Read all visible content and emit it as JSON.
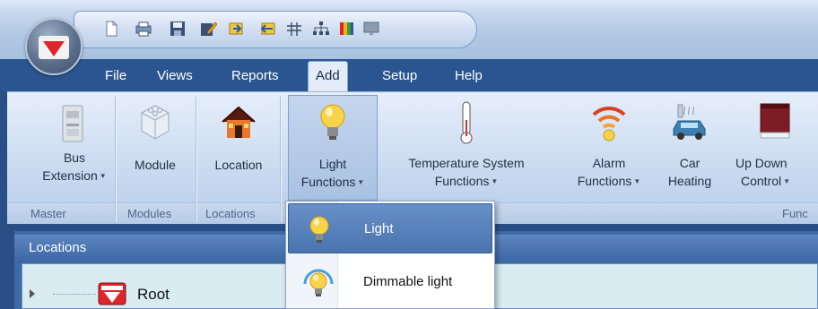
{
  "menu": {
    "tabs": [
      {
        "label": "File"
      },
      {
        "label": "Views"
      },
      {
        "label": "Reports"
      },
      {
        "label": "Add",
        "active": true
      },
      {
        "label": "Setup"
      },
      {
        "label": "Help"
      }
    ]
  },
  "quick_access": {
    "icons": [
      "new-document-icon",
      "print-icon",
      "save-icon",
      "edit-icon",
      "import-icon",
      "export-icon",
      "network-icon",
      "hierarchy-icon",
      "color-icon",
      "monitor-icon"
    ]
  },
  "ribbon": {
    "buttons": {
      "bus_extension": {
        "line1": "Bus",
        "line2": "Extension",
        "icon": "bus-extension-icon"
      },
      "module": {
        "label": "Module",
        "icon": "module-icon"
      },
      "location": {
        "label": "Location",
        "icon": "house-icon"
      },
      "light_functions": {
        "line1": "Light",
        "line2": "Functions",
        "icon": "bulb-icon"
      },
      "temperature": {
        "line1": "Temperature System",
        "line2": "Functions",
        "icon": "thermometer-icon"
      },
      "alarm": {
        "line1": "Alarm",
        "line2": "Functions",
        "icon": "alarm-icon"
      },
      "car_heating": {
        "line1": "Car",
        "line2": "Heating",
        "icon": "car-icon"
      },
      "up_down": {
        "line1": "Up Down",
        "line2": "Control",
        "icon": "blinds-icon"
      }
    },
    "groups": {
      "master": "Master",
      "modules": "Modules",
      "locations": "Locations",
      "functions": "Func"
    }
  },
  "panel": {
    "title": "Locations",
    "tree": {
      "root_label": "Root"
    }
  },
  "dropdown": {
    "items": [
      {
        "label": "Light",
        "selected": true,
        "icon": "bulb-icon"
      },
      {
        "label": "Dimmable light",
        "selected": false,
        "icon": "dimmable-bulb-icon"
      }
    ]
  },
  "colors": {
    "tab_bar": "#2b5590",
    "ribbon_bg": "#cbdcf1",
    "selected_item": "#4a74ae",
    "logo_red": "#e0242b"
  }
}
